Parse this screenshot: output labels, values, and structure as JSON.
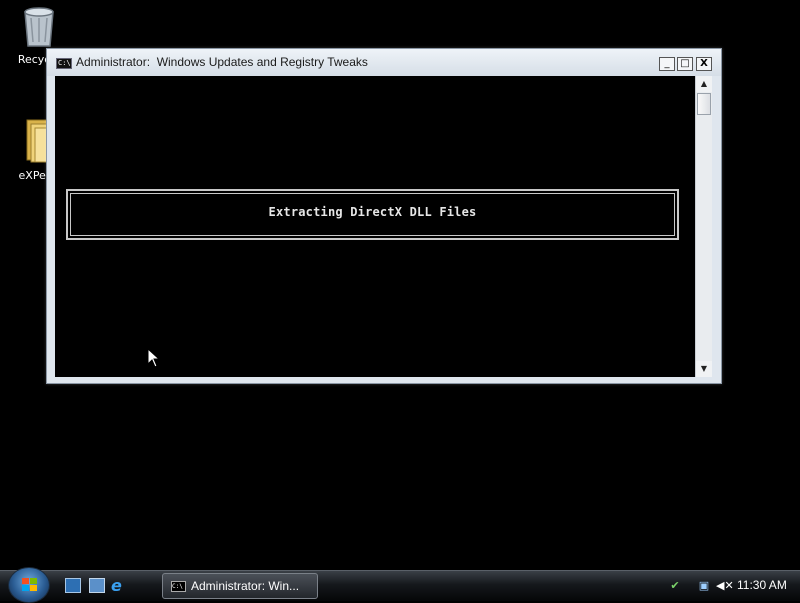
{
  "desktop": {
    "icons": [
      {
        "label": "Recycle",
        "icon": "recycle-bin-icon"
      },
      {
        "label": "eXPeric",
        "icon": "folder-icon"
      }
    ]
  },
  "window": {
    "title": "Administrator:  Windows Updates and Registry Tweaks",
    "icon": "cmd-icon",
    "controls": {
      "minimize": "_",
      "maximize": "□",
      "close": "X"
    },
    "console": {
      "message": "Extracting DirectX DLL Files"
    }
  },
  "taskbar": {
    "quick_launch": [
      "show-desktop-icon",
      "switch-windows-icon",
      "internet-explorer-icon"
    ],
    "task_button_label": "Administrator:  Win...",
    "tray_icons": [
      "network-icon",
      "connection-icon",
      "volume-muted-icon"
    ],
    "clock": "11:30 AM"
  },
  "colors": {
    "desktop_bg": "#000000",
    "console_bg": "#000000",
    "console_text": "#e6e6e6",
    "titlebar": "#dfe6ee"
  }
}
